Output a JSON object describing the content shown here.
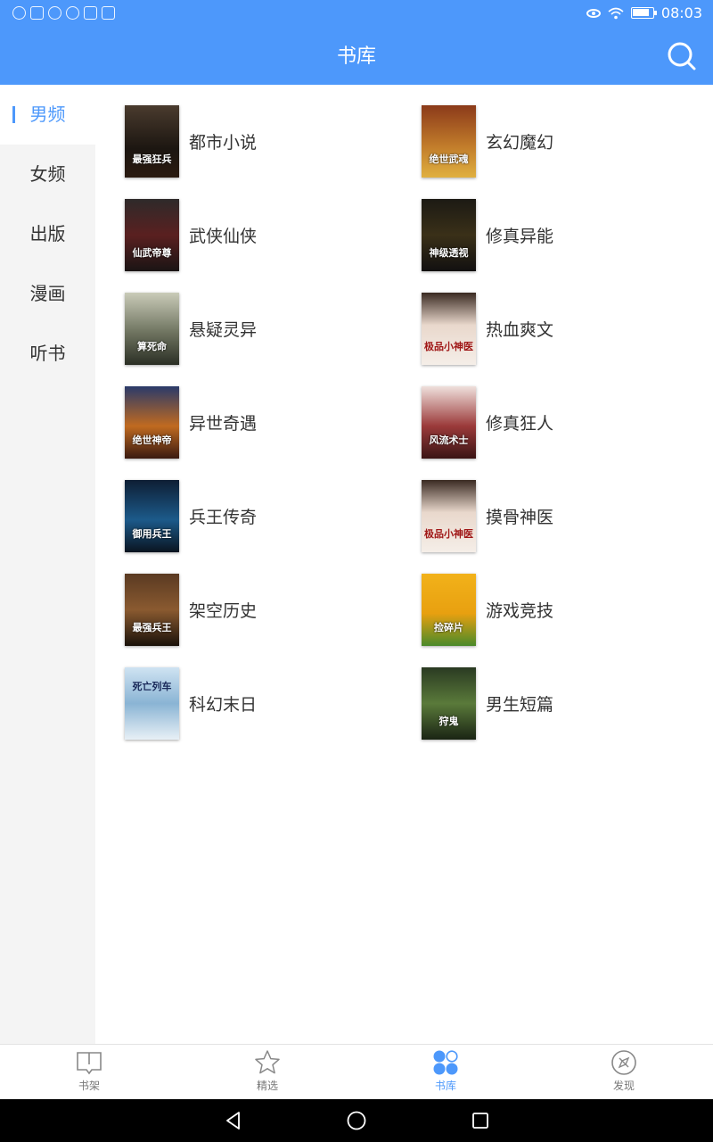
{
  "status_bar": {
    "time": "08:03"
  },
  "header": {
    "title": "书库"
  },
  "sidebar": {
    "items": [
      {
        "label": "男频",
        "active": true
      },
      {
        "label": "女频",
        "active": false
      },
      {
        "label": "出版",
        "active": false
      },
      {
        "label": "漫画",
        "active": false
      },
      {
        "label": "听书",
        "active": false
      }
    ]
  },
  "categories": [
    {
      "label": "都市小说",
      "cover_text": "最强狂兵"
    },
    {
      "label": "玄幻魔幻",
      "cover_text": "绝世武魂"
    },
    {
      "label": "武侠仙侠",
      "cover_text": "仙武帝尊"
    },
    {
      "label": "修真异能",
      "cover_text": "神级透视"
    },
    {
      "label": "悬疑灵异",
      "cover_text": "算死命"
    },
    {
      "label": "热血爽文",
      "cover_text": "极品小神医"
    },
    {
      "label": "异世奇遇",
      "cover_text": "绝世神帝"
    },
    {
      "label": "修真狂人",
      "cover_text": "风流术士"
    },
    {
      "label": "兵王传奇",
      "cover_text": "御用兵王"
    },
    {
      "label": "摸骨神医",
      "cover_text": "极品小神医"
    },
    {
      "label": "架空历史",
      "cover_text": "最强兵王"
    },
    {
      "label": "游戏竞技",
      "cover_text": "捡碎片"
    },
    {
      "label": "科幻末日",
      "cover_text": "死亡列车"
    },
    {
      "label": "男生短篇",
      "cover_text": "狩鬼"
    }
  ],
  "tabs": [
    {
      "label": "书架",
      "icon": "bookshelf-icon",
      "active": false
    },
    {
      "label": "精选",
      "icon": "star-icon",
      "active": false
    },
    {
      "label": "书库",
      "icon": "library-icon",
      "active": true
    },
    {
      "label": "发现",
      "icon": "compass-icon",
      "active": false
    }
  ],
  "colors": {
    "accent": "#4d98fb",
    "sidebar_bg": "#f4f4f4"
  }
}
